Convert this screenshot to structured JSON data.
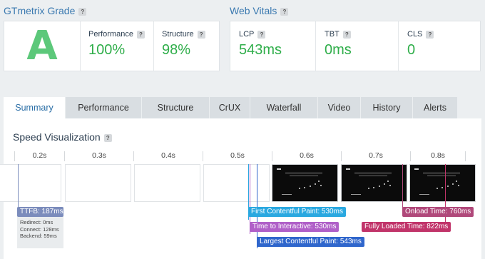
{
  "grade": {
    "title": "GTmetrix Grade",
    "letter": "A",
    "performance_label": "Performance",
    "performance_value": "100%",
    "structure_label": "Structure",
    "structure_value": "98%"
  },
  "vitals": {
    "title": "Web Vitals",
    "lcp_label": "LCP",
    "lcp_value": "543ms",
    "tbt_label": "TBT",
    "tbt_value": "0ms",
    "cls_label": "CLS",
    "cls_value": "0"
  },
  "help_glyph": "?",
  "tabs": [
    "Summary",
    "Performance",
    "Structure",
    "CrUX",
    "Waterfall",
    "Video",
    "History",
    "Alerts"
  ],
  "active_tab": "Summary",
  "speed": {
    "title": "Speed Visualization",
    "ticks": [
      "0.2s",
      "0.3s",
      "0.4s",
      "0.5s",
      "0.6s",
      "0.7s",
      "0.8s"
    ],
    "ttfb": "TTFB: 187ms",
    "redirect": "Redirect: 0ms",
    "connect": "Connect: 128ms",
    "backend": "Backend: 59ms",
    "fcp": "First Contentful Paint: 530ms",
    "tti": "Time to Interactive: 530ms",
    "lcp": "Largest Contentful Paint: 543ms",
    "onload": "Onload Time: 760ms",
    "fully_loaded": "Fully Loaded Time: 822ms"
  },
  "colors": {
    "grade_green": "#5cc87a",
    "value_green": "#2fae4a",
    "link_blue": "#3a79b0",
    "ttfb": "#7b8cbc",
    "fcp": "#2aa8e0",
    "tti": "#b060c8",
    "lcp": "#2f66cc",
    "onload": "#b0487a",
    "fully_loaded": "#c1346a"
  }
}
